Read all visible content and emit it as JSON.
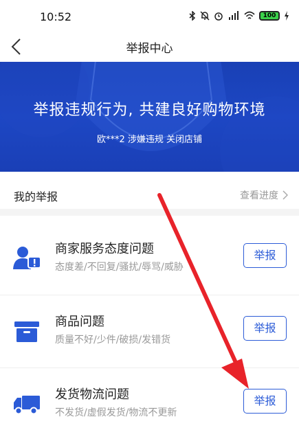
{
  "status_bar": {
    "time": "10:52",
    "battery": "100",
    "icons": [
      "bluetooth-icon",
      "mute-icon",
      "alarm-icon",
      "hd-signal-icon",
      "wifi-icon",
      "battery-icon",
      "charging-icon"
    ]
  },
  "navbar": {
    "title": "举报中心",
    "back_icon": "chevron-left-icon"
  },
  "banner": {
    "title": "举报违规行为, 共建良好购物环境",
    "subtitle": "欧***2 涉嫌违规 关闭店铺"
  },
  "my_report": {
    "label": "我的举报",
    "link_label": "查看进度"
  },
  "categories": [
    {
      "title": "商家服务态度问题",
      "desc": "态度差/不回复/骚扰/辱骂/威胁",
      "button": "举报",
      "icon": "user-alert-icon"
    },
    {
      "title": "商品问题",
      "desc": "质量不好/少件/破损/发错货",
      "button": "举报",
      "icon": "box-icon"
    },
    {
      "title": "发货物流问题",
      "desc": "不发货/虚假发货/物流不更新",
      "button": "举报",
      "icon": "truck-icon"
    }
  ],
  "colors": {
    "accent": "#2b5bd7",
    "banner": "#1d47c4",
    "icon": "#2b5bd7",
    "annotation_arrow": "#e8232a"
  }
}
